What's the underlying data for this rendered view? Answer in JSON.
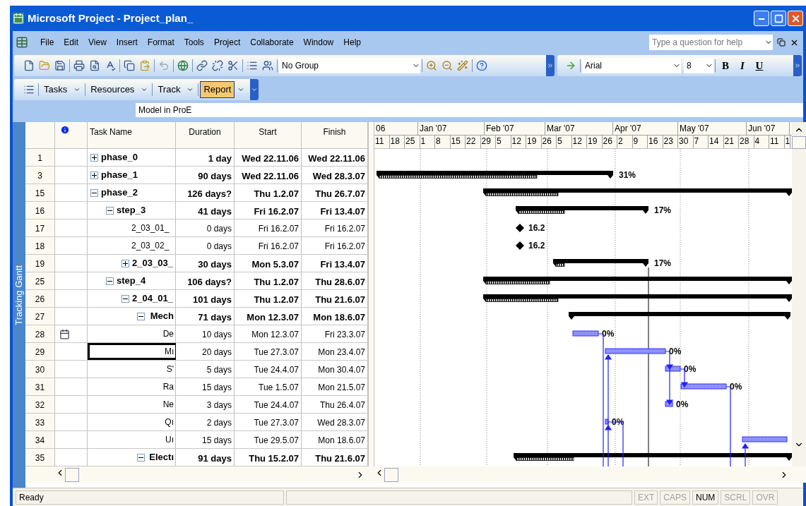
{
  "window": {
    "title": "Microsoft Project - Project_plan_"
  },
  "menu": [
    "File",
    "Edit",
    "View",
    "Insert",
    "Format",
    "Tools",
    "Project",
    "Collaborate",
    "Window",
    "Help"
  ],
  "help_box": {
    "placeholder": "Type a question for help"
  },
  "standard_toolbar": {
    "group": "No Group"
  },
  "formatting_toolbar": {
    "font": "Arial",
    "size": "8",
    "style_buttons": [
      {
        "kind": "bold",
        "label": "B"
      },
      {
        "kind": "italic",
        "label": "I"
      },
      {
        "kind": "underline",
        "label": "U"
      }
    ]
  },
  "guide_toolbar": [
    {
      "label": "Tasks",
      "highlighted": false
    },
    {
      "label": "Resources",
      "highlighted": false
    },
    {
      "label": "Track",
      "highlighted": false
    },
    {
      "label": "Report",
      "highlighted": true
    }
  ],
  "entry_bar": {
    "value": "Model in ProE"
  },
  "view_bar": {
    "label": "Tracking Gantt"
  },
  "table": {
    "columns": [
      "Task Name",
      "Duration",
      "Start",
      "Finish"
    ],
    "rows": [
      {
        "id": "1",
        "name": "phase_0",
        "duration": "1 day",
        "start": "Wed 22.11.06",
        "finish": "Wed 22.11.06",
        "summary": true,
        "expanded": false
      },
      {
        "id": "3",
        "name": "phase_1",
        "duration": "90 days",
        "start": "Wed 22.11.06",
        "finish": "Wed 28.3.07",
        "summary": true,
        "expanded": false,
        "bar": {
          "kind": "summary",
          "label": "31%"
        }
      },
      {
        "id": "15",
        "name": "phase_2",
        "duration": "126 days?",
        "start": "Thu 1.2.07",
        "finish": "Thu 26.7.07",
        "summary": true,
        "expanded": true,
        "bar": {
          "kind": "summary"
        },
        "children": [
          {
            "id": "16",
            "name": "step_3",
            "duration": "41 days",
            "start": "Fri 16.2.07",
            "finish": "Fri 13.4.07",
            "summary": true,
            "expanded": true,
            "bar": {
              "kind": "summary",
              "label": "17%"
            },
            "children": [
              {
                "id": "17",
                "name": "2_03_01_",
                "duration": "0 days",
                "start": "Fri 16.2.07",
                "finish": "Fri 16.2.07",
                "summary": false,
                "bar": {
                  "kind": "milestone",
                  "label": "16.2"
                }
              },
              {
                "id": "18",
                "name": "2_03_02_",
                "duration": "0 days",
                "start": "Fri 16.2.07",
                "finish": "Fri 16.2.07",
                "summary": false,
                "bar": {
                  "kind": "milestone",
                  "label": "16.2"
                }
              },
              {
                "id": "19",
                "name": "2_03_03_",
                "duration": "30 days",
                "start": "Mon 5.3.07",
                "finish": "Fri 13.4.07",
                "summary": true,
                "expanded": false,
                "bar": {
                  "kind": "summary",
                  "label": "17%"
                }
              }
            ]
          },
          {
            "id": "25",
            "name": "step_4",
            "duration": "106 days?",
            "start": "Thu 1.2.07",
            "finish": "Thu 28.6.07",
            "summary": true,
            "expanded": true,
            "bar": {
              "kind": "summary"
            },
            "children": [
              {
                "id": "26",
                "name": "2_04_01_",
                "duration": "101 days",
                "start": "Thu 1.2.07",
                "finish": "Thu 21.6.07",
                "summary": true,
                "expanded": true,
                "bar": {
                  "kind": "summary"
                },
                "children": [
                  {
                    "id": "27",
                    "name": "Mech",
                    "duration": "71 days",
                    "start": "Mon 12.3.07",
                    "finish": "Mon 18.6.07",
                    "summary": true,
                    "expanded": true,
                    "bar": {
                      "kind": "summary"
                    },
                    "children": [
                      {
                        "id": "28",
                        "name": "De",
                        "duration": "10 days",
                        "start": "Mon 12.3.07",
                        "finish": "Fri 23.3.07",
                        "summary": false,
                        "constraint": true,
                        "bar": {
                          "kind": "task",
                          "label": "0%"
                        }
                      },
                      {
                        "id": "29",
                        "name": "Mı",
                        "duration": "20 days",
                        "start": "Tue 27.3.07",
                        "finish": "Mon 23.4.07",
                        "summary": false,
                        "active": true,
                        "bar": {
                          "kind": "task",
                          "label": "0%"
                        }
                      },
                      {
                        "id": "30",
                        "name": "S'",
                        "duration": "5 days",
                        "start": "Tue 24.4.07",
                        "finish": "Mon 30.4.07",
                        "summary": false,
                        "bar": {
                          "kind": "task",
                          "label": "0%"
                        }
                      },
                      {
                        "id": "31",
                        "name": "Ra",
                        "duration": "15 days",
                        "start": "Tue 1.5.07",
                        "finish": "Mon 21.5.07",
                        "summary": false,
                        "bar": {
                          "kind": "task",
                          "label": "0%"
                        }
                      },
                      {
                        "id": "32",
                        "name": "Ne",
                        "duration": "3 days",
                        "start": "Tue 24.4.07",
                        "finish": "Thu 26.4.07",
                        "summary": false,
                        "bar": {
                          "kind": "task",
                          "label": "0%"
                        }
                      },
                      {
                        "id": "33",
                        "name": "Qı",
                        "duration": "2 days",
                        "start": "Tue 27.3.07",
                        "finish": "Wed 28.3.07",
                        "summary": false,
                        "bar": {
                          "kind": "task",
                          "label": "0%"
                        }
                      },
                      {
                        "id": "34",
                        "name": "Uı",
                        "duration": "15 days",
                        "start": "Tue 29.5.07",
                        "finish": "Mon 18.6.07",
                        "summary": false,
                        "bar": {
                          "kind": "task"
                        }
                      }
                    ]
                  },
                  {
                    "id": "35",
                    "name": "Electı",
                    "duration": "91 days",
                    "start": "Thu 15.2.07",
                    "finish": "Thu 21.6.07",
                    "summary": true,
                    "expanded": true,
                    "bar": {
                      "kind": "summary"
                    }
                  }
                ]
              }
            ]
          }
        ]
      }
    ]
  },
  "timescale": {
    "months": [
      "06",
      "Jan '07",
      "Feb '07",
      "Mar '07",
      "Apr '07",
      "May '07",
      "Jun '07"
    ],
    "weeks": [
      "11",
      "18",
      "25",
      "1",
      "8",
      "15",
      "22",
      "29",
      "5",
      "12",
      "19",
      "26",
      "5",
      "12",
      "19",
      "26",
      "2",
      "9",
      "16",
      "23",
      "30",
      "7",
      "14",
      "21",
      "28",
      "4",
      "11",
      "1"
    ]
  },
  "status_bar": {
    "text": "Ready",
    "indicators": [
      {
        "label": "EXT",
        "on": false
      },
      {
        "label": "CAPS",
        "on": false
      },
      {
        "label": "NUM",
        "on": true
      },
      {
        "label": "SCRL",
        "on": false
      },
      {
        "label": "OVR",
        "on": false
      }
    ]
  }
}
